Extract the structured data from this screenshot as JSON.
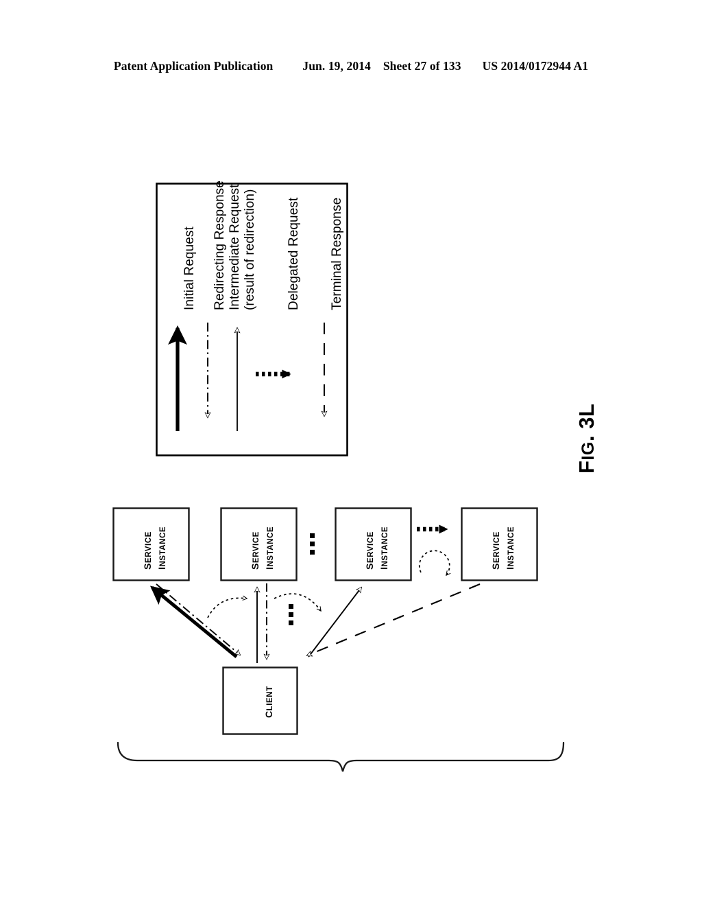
{
  "header": {
    "publication": "Patent Application Publication",
    "date": "Jun. 19, 2014",
    "sheet": "Sheet 27 of 133",
    "pub_number": "US 2014/0172944 A1"
  },
  "figure": {
    "label_prefix": "F",
    "label_rest": "IG",
    "label_suffix": ". 3L",
    "label_full": "FIG. 3L"
  },
  "legend": {
    "entries": [
      {
        "id": "initial-request",
        "line1": "Initial Request",
        "line2": "",
        "style": "thick-solid",
        "arrowhead": "filled",
        "direction": "up"
      },
      {
        "id": "redirecting-response",
        "line1": "Redirecting Response",
        "line2": "",
        "style": "dash-dot",
        "arrowhead": "hollow",
        "direction": "down"
      },
      {
        "id": "intermediate-request",
        "line1": "Intermediate Request",
        "line2": "(result of redirection)",
        "style": "thin-solid",
        "arrowhead": "hollow",
        "direction": "up"
      },
      {
        "id": "delegated-request",
        "line1": "Delegated Request",
        "line2": "",
        "style": "thick-dotted",
        "arrowhead": "filled-large",
        "direction": "right"
      },
      {
        "id": "terminal-response",
        "line1": "Terminal Response",
        "line2": "",
        "style": "dashed",
        "arrowhead": "hollow",
        "direction": "down"
      }
    ]
  },
  "diagram": {
    "service_instances": [
      {
        "id": "service-instance-1",
        "line1": "Service",
        "line2": "Instance"
      },
      {
        "id": "service-instance-2",
        "line1": "Service",
        "line2": "Instance"
      },
      {
        "id": "service-instance-3",
        "line1": "Service",
        "line2": "Instance"
      },
      {
        "id": "service-instance-4",
        "line1": "Service",
        "line2": "Instance"
      }
    ],
    "client": {
      "id": "client-node",
      "label": "Client"
    },
    "ellipsis_symbol": "vertical-ellipsis"
  },
  "colors": {
    "ink": "#000000",
    "paper": "#ffffff",
    "box_stroke": "#1a1a1a"
  }
}
